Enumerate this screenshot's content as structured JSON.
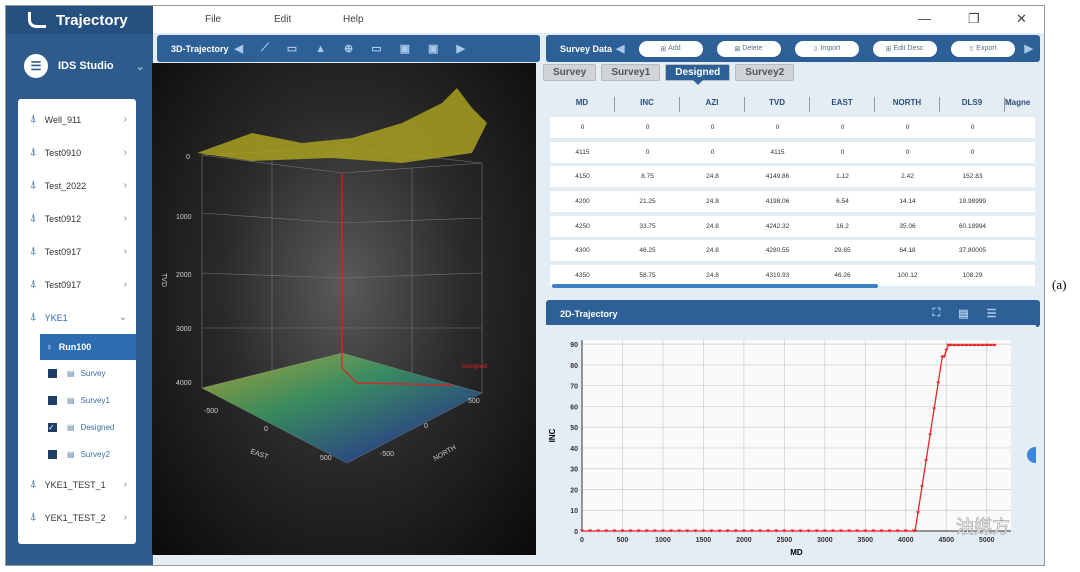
{
  "app": {
    "title": "Trajectory",
    "studio": "IDS Studio"
  },
  "menu": [
    "File",
    "Edit",
    "Help"
  ],
  "window_controls": {
    "minimize": "—",
    "restore": "❐",
    "close": "✕"
  },
  "tree": {
    "wells": [
      "Well_911",
      "Test0910",
      "Test_2022",
      "Test0912",
      "Test0917",
      "Test0917"
    ],
    "open_well": "YKE1",
    "run": "Run100",
    "surveys": [
      {
        "label": "Survey",
        "checked": false
      },
      {
        "label": "Survey1",
        "checked": false
      },
      {
        "label": "Designed",
        "checked": true
      },
      {
        "label": "Survey2",
        "checked": false
      }
    ],
    "more_wells": [
      "YKE1_TEST_1",
      "YEK1_TEST_2"
    ]
  },
  "panel3d": {
    "title": "3D-Trajectory",
    "tvd_label": "TVD",
    "east_label": "EAST",
    "north_label": "NORTH",
    "tvd_ticks": [
      "0",
      "1000",
      "2000",
      "3000",
      "4000"
    ],
    "east_ticks": [
      "-500",
      "0",
      "500"
    ],
    "north_ticks": [
      "-500",
      "0",
      "500"
    ],
    "well_label": "Designed"
  },
  "survey": {
    "title": "Survey Data",
    "buttons": [
      "Add",
      "Delete",
      "Import",
      "Edit Desc",
      "Export"
    ],
    "tabs": [
      "Survey",
      "Survey1",
      "Designed",
      "Survey2"
    ],
    "active_tab": "Designed",
    "columns": [
      "MD",
      "INC",
      "AZI",
      "TVD",
      "EAST",
      "NORTH",
      "DLS9",
      "Magne"
    ],
    "rows": [
      [
        "0",
        "0",
        "0",
        "0",
        "0",
        "0",
        "0"
      ],
      [
        "4115",
        "0",
        "0",
        "4115",
        "0",
        "0",
        "0"
      ],
      [
        "4150",
        "8.75",
        "24.8",
        "4149.86",
        "1.12",
        "2.42",
        "152.83"
      ],
      [
        "4200",
        "21.25",
        "24.8",
        "4198.06",
        "6.54",
        "14.14",
        "19.98999"
      ],
      [
        "4250",
        "33.75",
        "24.8",
        "4242.32",
        "16.2",
        "35.06",
        "60.18994"
      ],
      [
        "4300",
        "46.25",
        "24.8",
        "4280.55",
        "29.65",
        "64.18",
        "37.80005"
      ],
      [
        "4350",
        "58.75",
        "24.8",
        "4310.93",
        "46.26",
        "100.12",
        "108.29"
      ]
    ]
  },
  "panel2d": {
    "title": "2D-Trajectory"
  },
  "chart_data": {
    "type": "line",
    "xlabel": "MD",
    "ylabel": "INC",
    "xlim": [
      0,
      5300
    ],
    "ylim": [
      0,
      92
    ],
    "xticks": [
      "0",
      "500",
      "1000",
      "1500",
      "2000",
      "2500",
      "3000",
      "3500",
      "4000",
      "4500",
      "5000"
    ],
    "yticks": [
      "0",
      "10",
      "20",
      "30",
      "40",
      "50",
      "60",
      "70",
      "80",
      "90"
    ],
    "grid": true,
    "color": "#e8262a",
    "x": [
      0,
      100,
      200,
      300,
      400,
      500,
      600,
      700,
      800,
      900,
      1000,
      1100,
      1200,
      1300,
      1400,
      1500,
      1600,
      1700,
      1800,
      1900,
      2000,
      2100,
      2200,
      2300,
      2400,
      2500,
      2600,
      2700,
      2800,
      2900,
      3000,
      3100,
      3200,
      3300,
      3400,
      3500,
      3600,
      3700,
      3800,
      3900,
      4000,
      4100,
      4115,
      4150,
      4200,
      4250,
      4300,
      4350,
      4400,
      4450,
      4475,
      4500,
      4525,
      4550,
      4600,
      4650,
      4700,
      4750,
      4800,
      4850,
      4900,
      4950,
      5000,
      5050,
      5100
    ],
    "y": [
      0,
      0,
      0,
      0,
      0,
      0,
      0,
      0,
      0,
      0,
      0,
      0,
      0,
      0,
      0,
      0,
      0,
      0,
      0,
      0,
      0,
      0,
      0,
      0,
      0,
      0,
      0,
      0,
      0,
      0,
      0,
      0,
      0,
      0,
      0,
      0,
      0,
      0,
      0,
      0,
      0,
      0,
      0,
      8.75,
      21.25,
      33.75,
      46.25,
      58.75,
      71.25,
      83.75,
      84,
      87,
      89.5,
      89.5,
      89.5,
      89.5,
      89.5,
      89.5,
      89.5,
      89.5,
      89.5,
      89.5,
      89.5,
      89.5,
      89.5
    ]
  },
  "watermark": "油媒方",
  "figure_label": "(a)"
}
